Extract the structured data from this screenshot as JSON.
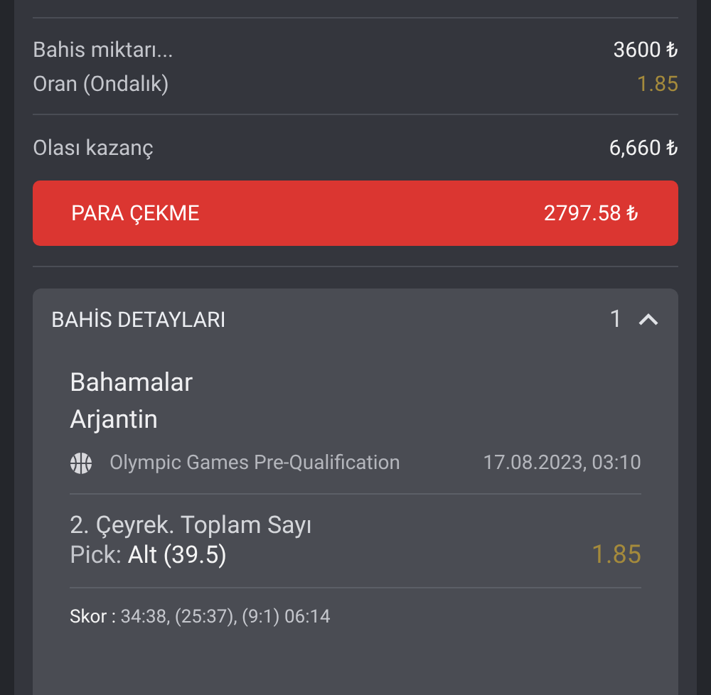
{
  "summary": [
    {
      "label": "Bahis miktarı...",
      "value": "3600 ₺",
      "kind": "amount"
    },
    {
      "label": "Oran (Ondalık)",
      "value": "1.85",
      "kind": "odds"
    }
  ],
  "payout": {
    "label": "Olası kazanç",
    "value": "6,660 ₺"
  },
  "cashout_button": {
    "label": "PARA ÇEKME",
    "value": "2797.58 ₺"
  },
  "details": {
    "title": "BAHİS DETAYLARI",
    "count": "1",
    "expanded": true,
    "teams": [
      "Bahamalar",
      "Arjantin"
    ],
    "league": "Olympic Games Pre-Qualification",
    "date": "17.08.2023, 03:10",
    "market": "2. Çeyrek. Toplam Sayı",
    "pick_label": "Pick:",
    "pick_value": "Alt (39.5)",
    "odds": "1.85",
    "score_label": "Skor :",
    "score_value": "34:38, (25:37), (9:1) 06:14"
  }
}
